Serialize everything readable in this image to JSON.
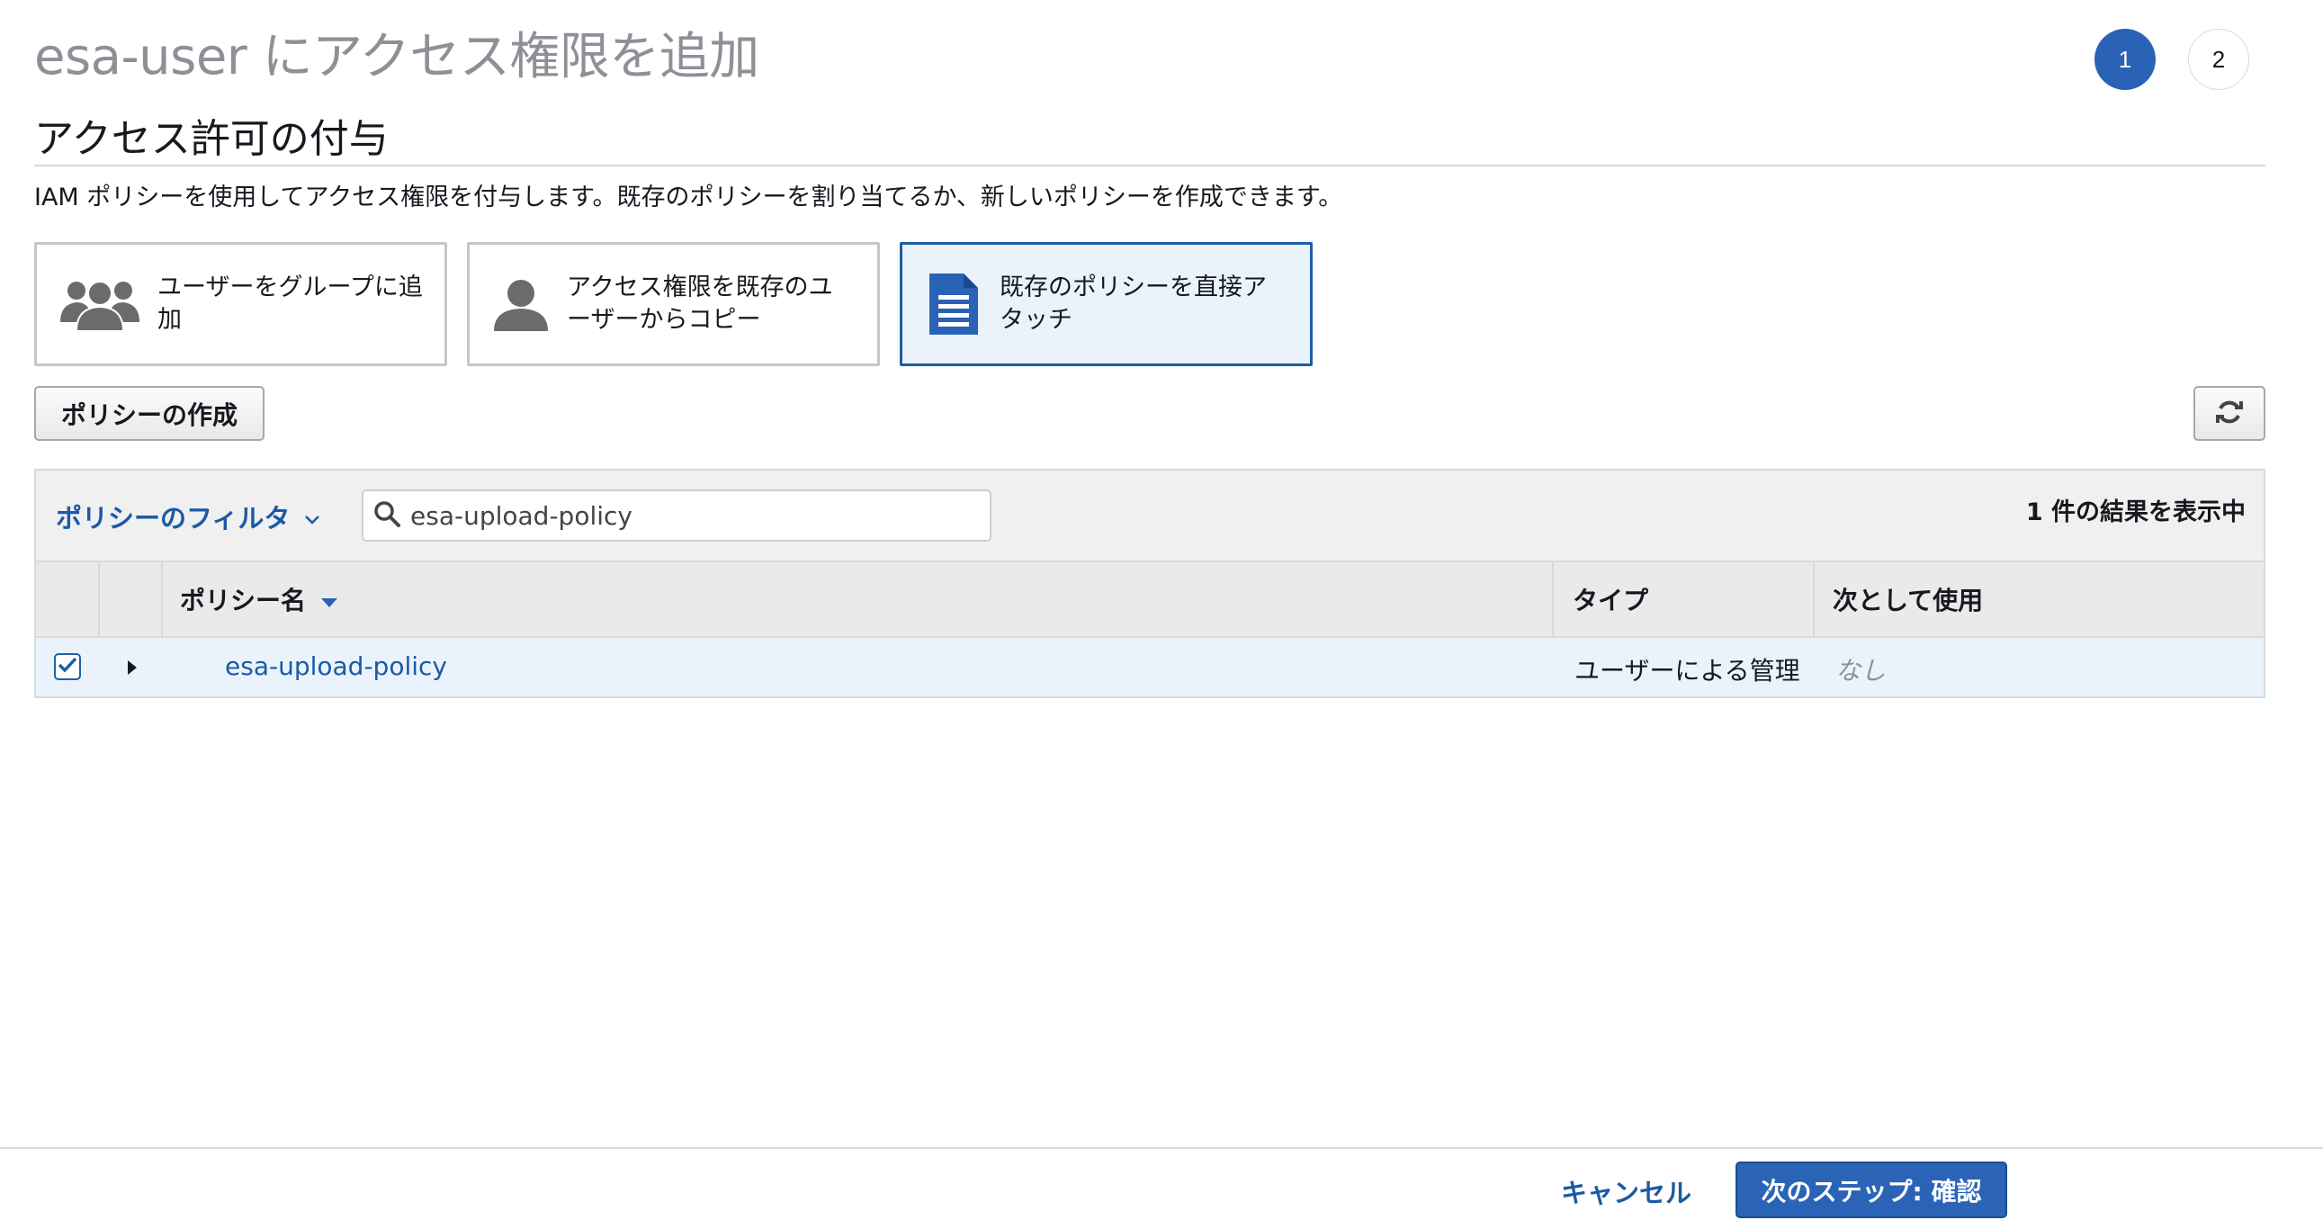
{
  "header": {
    "title": "esa-user にアクセス権限を追加",
    "steps": [
      {
        "label": "1",
        "active": true
      },
      {
        "label": "2",
        "active": false
      }
    ]
  },
  "section": {
    "title": "アクセス許可の付与",
    "description": "IAM ポリシーを使用してアクセス権限を付与します。既存のポリシーを割り当てるか、新しいポリシーを作成できます。"
  },
  "options": [
    {
      "label_line1": "ユーザーをグループに追",
      "label_line2": "加",
      "icon": "group-icon",
      "selected": false
    },
    {
      "label_line1": "アクセス権限を既存のユ",
      "label_line2": "ーザーからコピー",
      "icon": "user-icon",
      "selected": false
    },
    {
      "label_line1": "既存のポリシーを直接ア",
      "label_line2": "タッチ",
      "icon": "document-icon",
      "selected": true
    }
  ],
  "toolbar": {
    "create_policy_label": "ポリシーの作成",
    "refresh_icon": "refresh-icon"
  },
  "filter": {
    "label": "ポリシーのフィルタ",
    "search_value": "esa-upload-policy",
    "result_count": "1 件の結果を表示中"
  },
  "table": {
    "columns": [
      "ポリシー名",
      "タイプ",
      "次として使用"
    ],
    "rows": [
      {
        "checked": true,
        "name": "esa-upload-policy",
        "type": "ユーザーによる管理",
        "used_as": "なし"
      }
    ]
  },
  "footer": {
    "cancel_label": "キャンセル",
    "next_label": "次のステップ: 確認"
  },
  "colors": {
    "accent": "#2a63b5",
    "link": "#1a5aa5",
    "selected_bg": "#eaf3fb"
  }
}
